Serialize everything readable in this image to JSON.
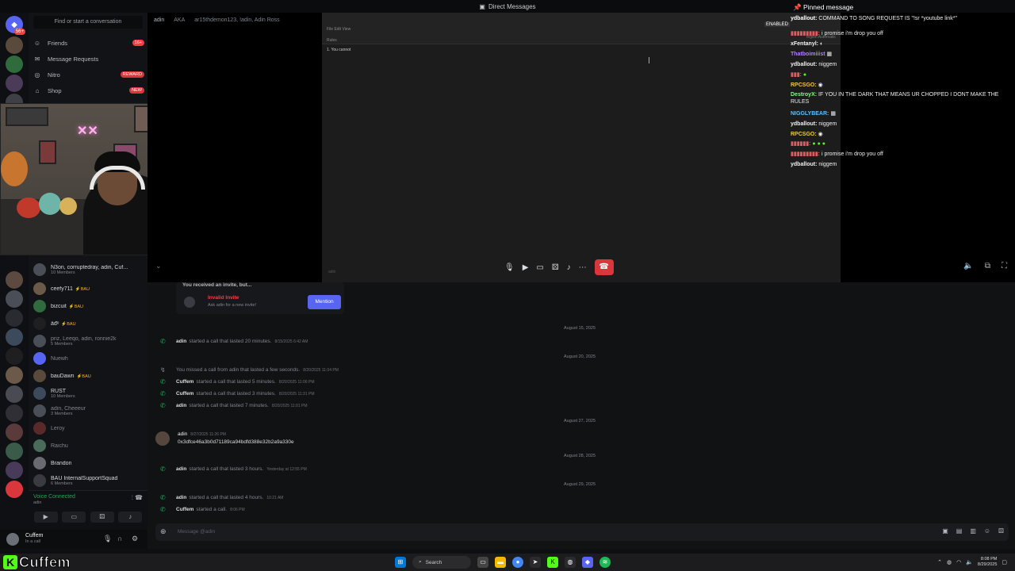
{
  "titlebar": {
    "title": "Direct Messages"
  },
  "dm_sidebar": {
    "search_placeholder": "Find or start a conversation",
    "nav": [
      {
        "icon": "friends-icon",
        "label": "Friends",
        "pill": "16+",
        "pill_color": "#f23f43"
      },
      {
        "icon": "message-requests-icon",
        "label": "Message Requests",
        "pill": "",
        "pill_color": ""
      },
      {
        "icon": "nitro-icon",
        "label": "Nitro",
        "pill": "REWARD",
        "pill_color": "#da373c"
      },
      {
        "icon": "shop-icon",
        "label": "Shop",
        "pill": "NEW",
        "pill_color": "#da373c"
      }
    ],
    "dms": [
      {
        "name": "N3on, corruptedray, adin, Cuf...",
        "sub": "10 Members",
        "tag": "",
        "dim": false
      },
      {
        "name": "ceefy711",
        "sub": "",
        "tag": "⚡BAU",
        "dim": false
      },
      {
        "name": "bizcuit",
        "sub": "",
        "tag": "⚡BAU",
        "dim": false
      },
      {
        "name": "ẩđᵉ",
        "sub": "",
        "tag": "⚡BAU",
        "dim": false
      },
      {
        "name": "priz, Leeqo, adin, ronnie2k",
        "sub": "5 Members",
        "tag": "",
        "dim": true
      },
      {
        "name": "Nuewh",
        "sub": "",
        "tag": "",
        "dim": true
      },
      {
        "name": "bauDawn",
        "sub": "",
        "tag": "⚡BAU",
        "dim": false
      },
      {
        "name": "RUST",
        "sub": "10 Members",
        "tag": "",
        "dim": false
      },
      {
        "name": "adin, Cheeeur",
        "sub": "3 Members",
        "tag": "",
        "dim": true
      },
      {
        "name": "Leroy",
        "sub": "",
        "tag": "",
        "dim": true
      },
      {
        "name": "Raichu",
        "sub": "",
        "tag": "",
        "dim": true
      },
      {
        "name": "Brandon",
        "sub": "",
        "tag": "",
        "dim": false
      },
      {
        "name": "BAU InternalSupportSquad",
        "sub": "6 Members",
        "tag": "",
        "dim": false
      }
    ],
    "voice": {
      "status": "Voice Connected",
      "channel": "adin"
    },
    "user": {
      "name": "Cuffem",
      "status": "In a call"
    }
  },
  "stage": {
    "name": "adin",
    "aka_label": "AKA",
    "aka_names": "ar15thdemon123, !adin, Adin Ross",
    "screen": {
      "rules_header": "Rules",
      "line1": "1. You cannot",
      "footer": "adin",
      "topright": "region   Automatic"
    }
  },
  "chat": {
    "enabled_label": "ENABLED",
    "pinned_label": "Pinned message",
    "lines": [
      {
        "user": "ydballout:",
        "color": "#ffffff",
        "text": "COMMAND TO SONG REQUEST IS \"!sr *youtube link*\""
      },
      {
        "user": "",
        "color": "#e05b5b",
        "text": "i promise i'm drop you off"
      },
      {
        "user": "xFentanyl:",
        "color": "#efeff1",
        "text": ""
      },
      {
        "user": "Thatboimiiist",
        "color": "#b07cff",
        "text": ""
      },
      {
        "user": "ydballout:",
        "color": "#efeff1",
        "text": "niggem"
      },
      {
        "user": "",
        "color": "#e05b5b",
        "text": ""
      },
      {
        "user": "RPCSGO:",
        "color": "#f0c84b",
        "text": ""
      },
      {
        "user": "DestroyX:",
        "color": "#7cff7c",
        "text": "IF YOU IN THE DARK THAT MEANS UR CHOPPED I DONT MAKE THE RULES"
      },
      {
        "user": "NIGGLYBEAR:",
        "color": "#5bc0ff",
        "text": ""
      },
      {
        "user": "ydballout:",
        "color": "#efeff1",
        "text": "niggem"
      },
      {
        "user": "RPCSGO:",
        "color": "#f0c84b",
        "text": ""
      },
      {
        "user": "",
        "color": "#e05b5b",
        "text": ""
      },
      {
        "user": "",
        "color": "#e05b5b",
        "text": "i promise i'm drop you off"
      },
      {
        "user": "ydballout:",
        "color": "#efeff1",
        "text": "niggem"
      }
    ]
  },
  "messages": {
    "invite": {
      "header": "You received an invite, but...",
      "title": "Invalid Invite",
      "sub": "Ask adin for a new invite!",
      "button": "Mention"
    },
    "entries": [
      {
        "kind": "date",
        "text": "August 15, 2025"
      },
      {
        "kind": "call",
        "missed": false,
        "user": "adin",
        "text": "started a call that lasted 20 minutes.",
        "ts": "8/15/2025 6:42 AM"
      },
      {
        "kind": "date",
        "text": "August 20, 2025"
      },
      {
        "kind": "call",
        "missed": true,
        "user": "",
        "text": "You missed a call from adin that lasted a few seconds.",
        "ts": "8/20/2025 11:04 PM"
      },
      {
        "kind": "call",
        "missed": false,
        "user": "Cuffem",
        "text": "started a call that lasted 5 minutes.",
        "ts": "8/20/2025 11:06 PM"
      },
      {
        "kind": "call",
        "missed": false,
        "user": "Cuffem",
        "text": "started a call that lasted 3 minutes.",
        "ts": "8/20/2025 11:31 PM"
      },
      {
        "kind": "call",
        "missed": false,
        "user": "adin",
        "text": "started a call that lasted 7 minutes.",
        "ts": "8/20/2025 11:01 PM"
      },
      {
        "kind": "date",
        "text": "August 27, 2025"
      },
      {
        "kind": "date",
        "text": "August 28, 2025"
      },
      {
        "kind": "call",
        "missed": false,
        "user": "adin",
        "text": "started a call that lasted 3 hours.",
        "ts": "Yesterday at 12:55 PM"
      },
      {
        "kind": "date",
        "text": "August 29, 2025"
      },
      {
        "kind": "call",
        "missed": false,
        "user": "adin",
        "text": "started a call that lasted 4 hours.",
        "ts": "10:21 AM"
      },
      {
        "kind": "call",
        "missed": false,
        "user": "Cuffem",
        "text": "started a call.",
        "ts": "8:06 PM"
      }
    ],
    "post": {
      "user": "adin",
      "ts": "8/27/2025 11:26 PM",
      "text": "0x3dfce46a3b0d71189ca94bdfd388e32b2a9a330e"
    },
    "composer_placeholder": "Message @adin"
  },
  "taskbar": {
    "brand": "Cuffem",
    "brand_color": "#53fc18",
    "search": "Search",
    "time": "8:08 PM",
    "date": "8/29/2025"
  }
}
